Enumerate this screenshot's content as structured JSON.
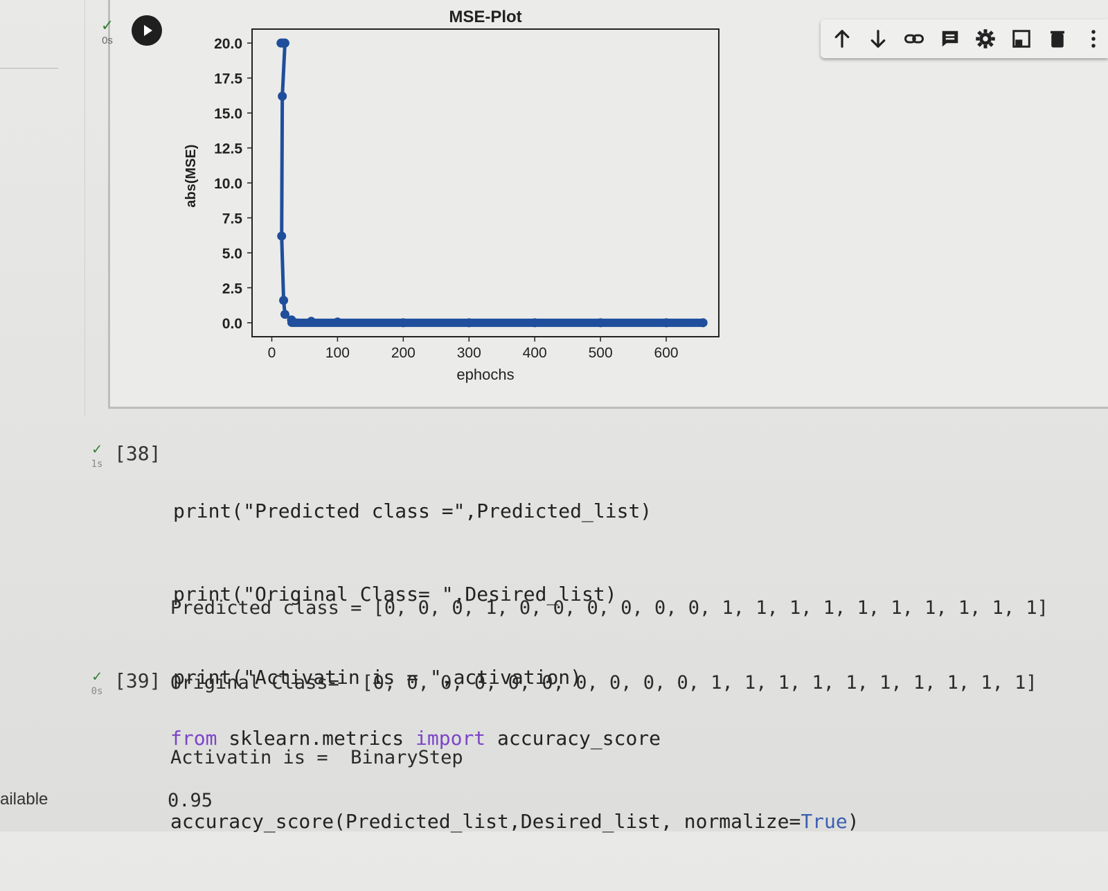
{
  "cell1": {
    "check": "✓",
    "time": "0s"
  },
  "toolbar": {
    "buttons": [
      {
        "name": "move-up-icon",
        "glyph": "arrow-up"
      },
      {
        "name": "move-down-icon",
        "glyph": "arrow-down"
      },
      {
        "name": "link-icon",
        "glyph": "link"
      },
      {
        "name": "comment-icon",
        "glyph": "comment"
      },
      {
        "name": "settings-icon",
        "glyph": "gear"
      },
      {
        "name": "mirror-cell-icon",
        "glyph": "mirror"
      },
      {
        "name": "delete-icon",
        "glyph": "trash"
      },
      {
        "name": "more-icon",
        "glyph": "kebab"
      }
    ]
  },
  "chart_data": {
    "type": "line",
    "title": "MSE-Plot",
    "xlabel": "ephochs",
    "ylabel": "abs(MSE)",
    "xlim": [
      -30,
      680
    ],
    "ylim": [
      -1.0,
      21.0
    ],
    "xticks": [
      0,
      100,
      200,
      300,
      400,
      500,
      600
    ],
    "yticks": [
      0.0,
      2.5,
      5.0,
      7.5,
      10.0,
      12.5,
      15.0,
      17.5,
      20.0
    ],
    "ytick_labels": [
      "0.0",
      "2.5",
      "5.0",
      "7.5",
      "10.0",
      "12.5",
      "15.0",
      "17.5",
      "20.0"
    ],
    "grid": false,
    "series": [
      {
        "color": "#1f4e9c",
        "x": [
          14,
          16,
          18,
          20,
          16,
          15,
          18,
          20,
          30,
          60,
          100,
          200,
          300,
          400,
          500,
          600,
          656
        ],
        "y": [
          20.0,
          20.0,
          20.0,
          20.0,
          16.2,
          6.2,
          1.6,
          0.6,
          0.2,
          0.1,
          0.05,
          0.0,
          0.0,
          0.0,
          0.0,
          0.0,
          0.0
        ]
      }
    ]
  },
  "cell2": {
    "check": "✓",
    "time": "1s",
    "number": "[38]",
    "code": [
      "print(\"Predicted class =\",Predicted_list)",
      "print(\"Original Class= \",Desired_list)",
      "print(\"Activatin is = \",activation)"
    ],
    "output": [
      "Predicted class = [0, 0, 0, 1, 0, 0, 0, 0, 0, 0, 1, 1, 1, 1, 1, 1, 1, 1, 1, 1]",
      "Original Class=  [0, 0, 0, 0, 0, 0, 0, 0, 0, 0, 1, 1, 1, 1, 1, 1, 1, 1, 1, 1]",
      "Activatin is =  BinaryStep"
    ]
  },
  "cell3": {
    "check": "✓",
    "time": "0s",
    "number": "[39]",
    "code_line1": {
      "kw_from": "from",
      "module": " sklearn.metrics ",
      "kw_import": "import",
      "name": " accuracy_score"
    },
    "code_line2": {
      "pre": "accuracy_score(Predicted_list,Desired_list, normalize=",
      "kw_true": "True",
      "post": ")"
    },
    "output": "0.95"
  },
  "status_left": "ailable"
}
